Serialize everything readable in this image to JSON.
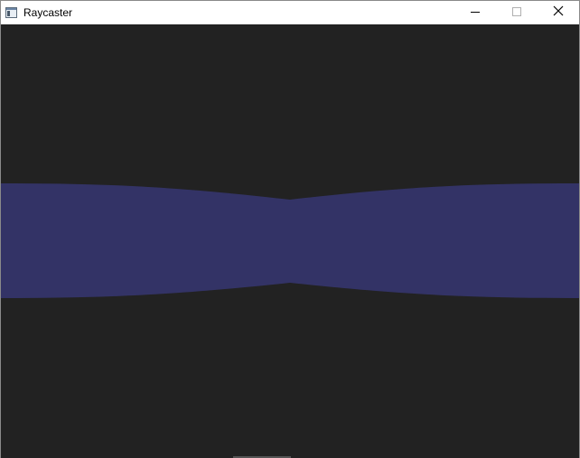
{
  "window": {
    "title": "Raycaster",
    "controls": {
      "minimize": "minimize",
      "maximize": "maximize",
      "close": "close"
    }
  },
  "scene": {
    "background_color": "#222222",
    "wall_color": "#333366",
    "icons": {
      "app": "app-window-icon",
      "minimize": "minimize-icon",
      "maximize": "maximize-icon",
      "close": "close-icon"
    }
  }
}
